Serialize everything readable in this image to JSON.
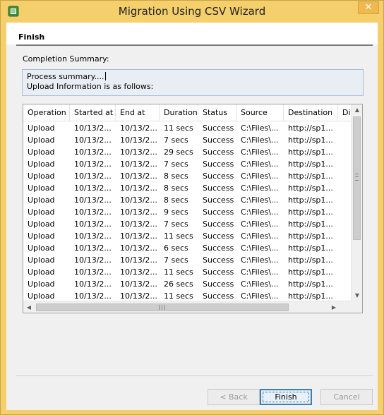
{
  "window": {
    "title": "Migration Using CSV Wizard",
    "close_glyph": "✕"
  },
  "header": {
    "heading": "Finish"
  },
  "summary": {
    "label": "Completion Summary:",
    "line1": "Process summary....",
    "line2": "Upload Information is as follows:"
  },
  "grid": {
    "columns": [
      "Operation",
      "Started at",
      "End at",
      "Duration",
      "Status",
      "Source",
      "Destination",
      "Di"
    ],
    "rows": [
      [
        "Upload",
        "10/13/2...",
        "10/13/2...",
        "11 secs",
        "Success",
        "C:\\Files\\...",
        "http://sp1..."
      ],
      [
        "Upload",
        "10/13/2...",
        "10/13/2...",
        "7 secs",
        "Success",
        "C:\\Files\\...",
        "http://sp1..."
      ],
      [
        "Upload",
        "10/13/2...",
        "10/13/2...",
        "29 secs",
        "Success",
        "C:\\Files\\...",
        "http://sp1..."
      ],
      [
        "Upload",
        "10/13/2...",
        "10/13/2...",
        "7 secs",
        "Success",
        "C:\\Files\\...",
        "http://sp1..."
      ],
      [
        "Upload",
        "10/13/2...",
        "10/13/2...",
        "8 secs",
        "Success",
        "C:\\Files\\...",
        "http://sp1..."
      ],
      [
        "Upload",
        "10/13/2...",
        "10/13/2...",
        "8 secs",
        "Success",
        "C:\\Files\\...",
        "http://sp1..."
      ],
      [
        "Upload",
        "10/13/2...",
        "10/13/2...",
        "8 secs",
        "Success",
        "C:\\Files\\...",
        "http://sp1..."
      ],
      [
        "Upload",
        "10/13/2...",
        "10/13/2...",
        "9 secs",
        "Success",
        "C:\\Files\\...",
        "http://sp1..."
      ],
      [
        "Upload",
        "10/13/2...",
        "10/13/2...",
        "7 secs",
        "Success",
        "C:\\Files\\...",
        "http://sp1..."
      ],
      [
        "Upload",
        "10/13/2...",
        "10/13/2...",
        "11 secs",
        "Success",
        "C:\\Files\\...",
        "http://sp1..."
      ],
      [
        "Upload",
        "10/13/2...",
        "10/13/2...",
        "6 secs",
        "Success",
        "C:\\Files\\...",
        "http://sp1..."
      ],
      [
        "Upload",
        "10/13/2...",
        "10/13/2...",
        "7 secs",
        "Success",
        "C:\\Files\\...",
        "http://sp1..."
      ],
      [
        "Upload",
        "10/13/2...",
        "10/13/2...",
        "11 secs",
        "Success",
        "C:\\Files\\...",
        "http://sp1..."
      ],
      [
        "Upload",
        "10/13/2...",
        "10/13/2...",
        "26 secs",
        "Success",
        "C:\\Files\\...",
        "http://sp1..."
      ],
      [
        "Upload",
        "10/13/2...",
        "10/13/2...",
        "11 secs",
        "Success",
        "C:\\Files\\...",
        "http://sp1..."
      ]
    ],
    "vscroll_grip": "≡",
    "hscroll_grip": "III"
  },
  "buttons": {
    "back": "< Back",
    "finish": "Finish",
    "cancel": "Cancel"
  },
  "colors": {
    "frame": "#f5cf6c",
    "primary_button_border": "#3c7fb1",
    "summary_box": "#e9eef4"
  },
  "icons": {
    "app": "csv-wizard-icon",
    "close": "close-icon"
  }
}
